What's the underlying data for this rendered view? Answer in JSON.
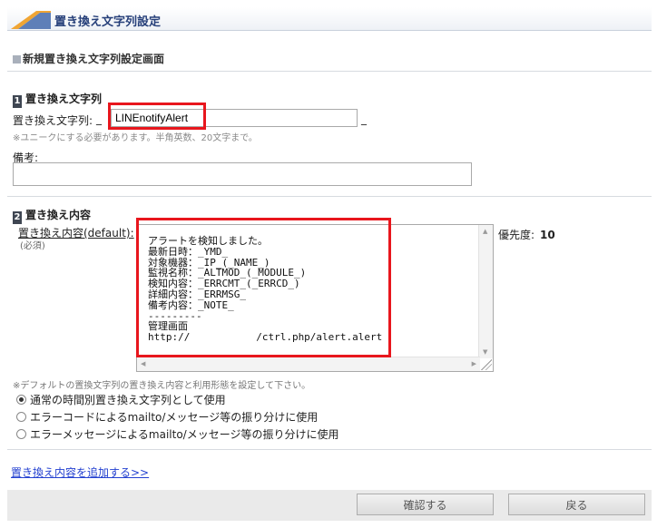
{
  "header": {
    "title": "置き換え文字列設定"
  },
  "page": {
    "subtitle": "新規置き換え文字列設定画面"
  },
  "section1": {
    "number": "1",
    "title": "置き換え文字列",
    "field_label": "置き換え文字列:",
    "prefix": "_",
    "value": "LINEnotifyAlert",
    "suffix": "_",
    "note": "※ユニークにする必要があります。半角英数、20文字まで。",
    "memo_label": "備考:",
    "memo_value": ""
  },
  "section2": {
    "number": "2",
    "title": "置き換え内容",
    "content_label": "置き換え内容(default):",
    "required_label": "(必須)",
    "content_value": "アラートを検知しました。\n最新日時：_YMD_\n対象機器：_IP_(_NAME_)\n監視名称：_ALTMOD_(_MODULE_)\n検知内容：_ERRCMT_(_ERRCD_)\n詳細内容：_ERRMSG_\n備考内容：_NOTE_\n---------\n管理画面\nhttp://           /ctrl.php/alert.alert",
    "priority_label": "優先度:",
    "priority_value": "10",
    "note": "※デフォルトの置換文字列の置き換え内容と利用形態を設定して下さい。",
    "options": [
      {
        "label": "通常の時間別置き換え文字列として使用",
        "selected": true
      },
      {
        "label": "エラーコードによるmailto/メッセージ等の振り分けに使用",
        "selected": false
      },
      {
        "label": "エラーメッセージによるmailto/メッセージ等の振り分けに使用",
        "selected": false
      }
    ]
  },
  "add_link": "置き換え内容を追加する>>",
  "footer": {
    "confirm_label": "確認する",
    "back_label": "戻る"
  },
  "colors": {
    "highlight": "#e8161d",
    "link": "#2340d0",
    "header_text": "#27407a"
  }
}
